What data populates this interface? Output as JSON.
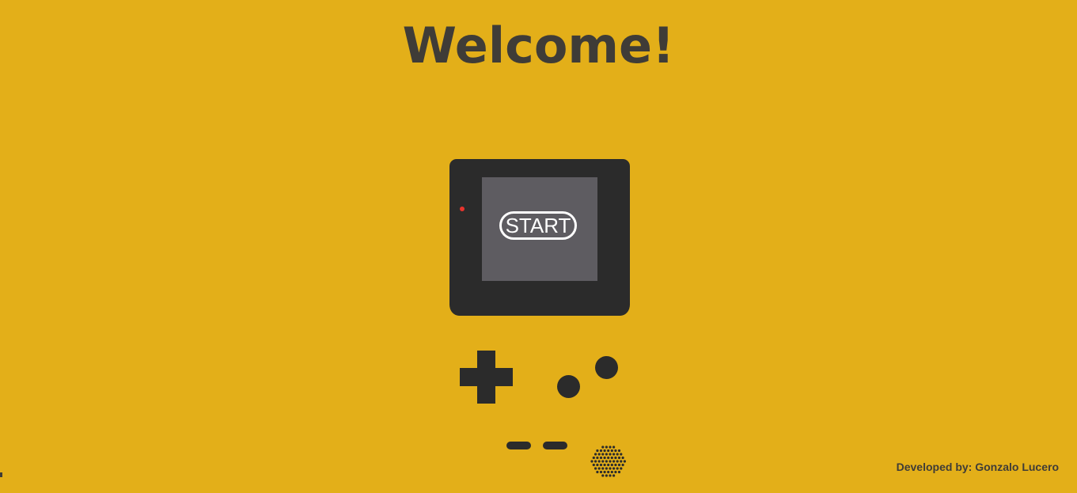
{
  "header": {
    "title": "Welcome!"
  },
  "console": {
    "start_label": "START",
    "led_icon": "power-led-icon",
    "dpad_icon": "dpad-icon",
    "speaker_icon": "speaker-grille-icon"
  },
  "footer": {
    "credit": "Developed by: Gonzalo Lucero"
  },
  "colors": {
    "background": "#e3af19",
    "console_body": "#2b2b2b",
    "screen": "#5e5c61",
    "led": "#e8342d",
    "text": "#3f3c37"
  }
}
